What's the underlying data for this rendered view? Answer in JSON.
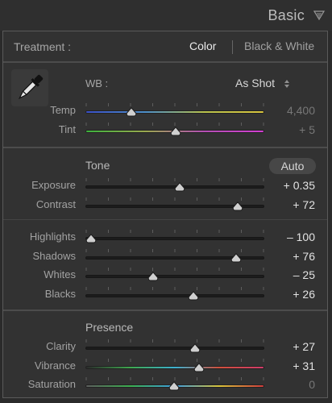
{
  "header": {
    "title": "Basic"
  },
  "treatment": {
    "label": "Treatment :",
    "options": [
      "Color",
      "Black & White"
    ],
    "selected": "Color"
  },
  "wb": {
    "label": "WB :",
    "value": "As Shot"
  },
  "sections": {
    "tone": "Tone",
    "auto": "Auto",
    "presence": "Presence"
  },
  "sliders": [
    {
      "name": "temp",
      "label": "Temp",
      "value": "4,400",
      "position": 0.26,
      "track": "temp",
      "dim": true
    },
    {
      "name": "tint",
      "label": "Tint",
      "value": "+ 5",
      "position": 0.51,
      "track": "tint",
      "dim": true
    },
    {
      "name": "exposure",
      "label": "Exposure",
      "value": "+ 0.35",
      "position": 0.53,
      "track": "plain",
      "dim": false
    },
    {
      "name": "contrast",
      "label": "Contrast",
      "value": "+ 72",
      "position": 0.86,
      "track": "plain",
      "dim": false
    },
    {
      "name": "highlights",
      "label": "Highlights",
      "value": "– 100",
      "position": 0.03,
      "track": "plain",
      "dim": false
    },
    {
      "name": "shadows",
      "label": "Shadows",
      "value": "+ 76",
      "position": 0.85,
      "track": "plain",
      "dim": false
    },
    {
      "name": "whites",
      "label": "Whites",
      "value": "– 25",
      "position": 0.38,
      "track": "plain",
      "dim": false
    },
    {
      "name": "blacks",
      "label": "Blacks",
      "value": "+ 26",
      "position": 0.61,
      "track": "plain",
      "dim": false
    },
    {
      "name": "clarity",
      "label": "Clarity",
      "value": "+ 27",
      "position": 0.62,
      "track": "plain",
      "dim": false
    },
    {
      "name": "vibrance",
      "label": "Vibrance",
      "value": "+ 31",
      "position": 0.64,
      "track": "vib",
      "dim": false
    },
    {
      "name": "saturation",
      "label": "Saturation",
      "value": "0",
      "position": 0.5,
      "track": "sat",
      "dim": true
    }
  ],
  "icons": {
    "panel_toggle": "triangle-down-icon",
    "eyedropper": "eyedropper-icon",
    "wb_arrows": "up-down-arrows-icon"
  },
  "colors": {
    "panel_bg": "#323232",
    "text": "#a8a8a8",
    "value_text": "#e2e2e2"
  }
}
